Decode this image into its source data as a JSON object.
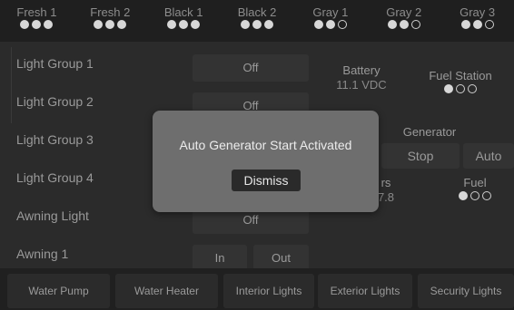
{
  "tanks": [
    {
      "name": "Fresh 1",
      "level": [
        1,
        1,
        1
      ]
    },
    {
      "name": "Fresh 2",
      "level": [
        1,
        1,
        1
      ]
    },
    {
      "name": "Black 1",
      "level": [
        1,
        1,
        1
      ]
    },
    {
      "name": "Black 2",
      "level": [
        1,
        1,
        1
      ]
    },
    {
      "name": "Gray 1",
      "level": [
        1,
        1,
        0
      ]
    },
    {
      "name": "Gray 2",
      "level": [
        1,
        1,
        0
      ]
    },
    {
      "name": "Gray 3",
      "level": [
        1,
        1,
        0
      ]
    }
  ],
  "lights": [
    {
      "label": "Light Group 1",
      "state": "Off"
    },
    {
      "label": "Light Group 2",
      "state": "Off"
    },
    {
      "label": "Light Group 3",
      "state": ""
    },
    {
      "label": "Light Group 4",
      "state": ""
    },
    {
      "label": "Awning Light",
      "state": "Off"
    },
    {
      "label": "Awning 1",
      "in_label": "In",
      "out_label": "Out"
    }
  ],
  "battery": {
    "title": "Battery",
    "value": "11.1 VDC"
  },
  "fuel_station": {
    "title": "Fuel Station",
    "level": [
      1,
      0,
      0
    ]
  },
  "generator": {
    "title": "Generator",
    "stop_label": "Stop",
    "auto_label": "Auto"
  },
  "hours": {
    "title_partial": "rs",
    "value_partial": "7.8"
  },
  "fuel": {
    "title": "Fuel",
    "level": [
      1,
      0,
      0
    ]
  },
  "bottom_buttons": [
    "Water Pump",
    "Water Heater",
    "Interior Lights",
    "Exterior Lights",
    "Security Lights"
  ],
  "modal": {
    "message": "Auto Generator Start Activated",
    "button": "Dismiss"
  }
}
